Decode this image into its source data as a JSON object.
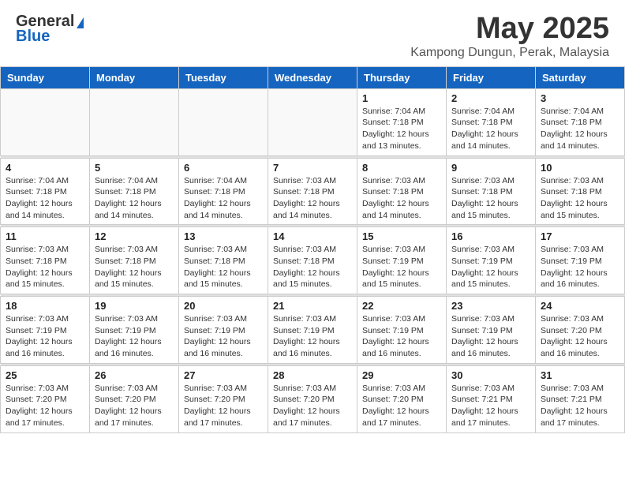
{
  "header": {
    "logo_general": "General",
    "logo_blue": "Blue",
    "title": "May 2025",
    "location": "Kampong Dungun, Perak, Malaysia"
  },
  "days_of_week": [
    "Sunday",
    "Monday",
    "Tuesday",
    "Wednesday",
    "Thursday",
    "Friday",
    "Saturday"
  ],
  "weeks": [
    [
      {
        "day": "",
        "info": ""
      },
      {
        "day": "",
        "info": ""
      },
      {
        "day": "",
        "info": ""
      },
      {
        "day": "",
        "info": ""
      },
      {
        "day": "1",
        "info": "Sunrise: 7:04 AM\nSunset: 7:18 PM\nDaylight: 12 hours\nand 13 minutes."
      },
      {
        "day": "2",
        "info": "Sunrise: 7:04 AM\nSunset: 7:18 PM\nDaylight: 12 hours\nand 14 minutes."
      },
      {
        "day": "3",
        "info": "Sunrise: 7:04 AM\nSunset: 7:18 PM\nDaylight: 12 hours\nand 14 minutes."
      }
    ],
    [
      {
        "day": "4",
        "info": "Sunrise: 7:04 AM\nSunset: 7:18 PM\nDaylight: 12 hours\nand 14 minutes."
      },
      {
        "day": "5",
        "info": "Sunrise: 7:04 AM\nSunset: 7:18 PM\nDaylight: 12 hours\nand 14 minutes."
      },
      {
        "day": "6",
        "info": "Sunrise: 7:04 AM\nSunset: 7:18 PM\nDaylight: 12 hours\nand 14 minutes."
      },
      {
        "day": "7",
        "info": "Sunrise: 7:03 AM\nSunset: 7:18 PM\nDaylight: 12 hours\nand 14 minutes."
      },
      {
        "day": "8",
        "info": "Sunrise: 7:03 AM\nSunset: 7:18 PM\nDaylight: 12 hours\nand 14 minutes."
      },
      {
        "day": "9",
        "info": "Sunrise: 7:03 AM\nSunset: 7:18 PM\nDaylight: 12 hours\nand 15 minutes."
      },
      {
        "day": "10",
        "info": "Sunrise: 7:03 AM\nSunset: 7:18 PM\nDaylight: 12 hours\nand 15 minutes."
      }
    ],
    [
      {
        "day": "11",
        "info": "Sunrise: 7:03 AM\nSunset: 7:18 PM\nDaylight: 12 hours\nand 15 minutes."
      },
      {
        "day": "12",
        "info": "Sunrise: 7:03 AM\nSunset: 7:18 PM\nDaylight: 12 hours\nand 15 minutes."
      },
      {
        "day": "13",
        "info": "Sunrise: 7:03 AM\nSunset: 7:18 PM\nDaylight: 12 hours\nand 15 minutes."
      },
      {
        "day": "14",
        "info": "Sunrise: 7:03 AM\nSunset: 7:18 PM\nDaylight: 12 hours\nand 15 minutes."
      },
      {
        "day": "15",
        "info": "Sunrise: 7:03 AM\nSunset: 7:19 PM\nDaylight: 12 hours\nand 15 minutes."
      },
      {
        "day": "16",
        "info": "Sunrise: 7:03 AM\nSunset: 7:19 PM\nDaylight: 12 hours\nand 15 minutes."
      },
      {
        "day": "17",
        "info": "Sunrise: 7:03 AM\nSunset: 7:19 PM\nDaylight: 12 hours\nand 16 minutes."
      }
    ],
    [
      {
        "day": "18",
        "info": "Sunrise: 7:03 AM\nSunset: 7:19 PM\nDaylight: 12 hours\nand 16 minutes."
      },
      {
        "day": "19",
        "info": "Sunrise: 7:03 AM\nSunset: 7:19 PM\nDaylight: 12 hours\nand 16 minutes."
      },
      {
        "day": "20",
        "info": "Sunrise: 7:03 AM\nSunset: 7:19 PM\nDaylight: 12 hours\nand 16 minutes."
      },
      {
        "day": "21",
        "info": "Sunrise: 7:03 AM\nSunset: 7:19 PM\nDaylight: 12 hours\nand 16 minutes."
      },
      {
        "day": "22",
        "info": "Sunrise: 7:03 AM\nSunset: 7:19 PM\nDaylight: 12 hours\nand 16 minutes."
      },
      {
        "day": "23",
        "info": "Sunrise: 7:03 AM\nSunset: 7:19 PM\nDaylight: 12 hours\nand 16 minutes."
      },
      {
        "day": "24",
        "info": "Sunrise: 7:03 AM\nSunset: 7:20 PM\nDaylight: 12 hours\nand 16 minutes."
      }
    ],
    [
      {
        "day": "25",
        "info": "Sunrise: 7:03 AM\nSunset: 7:20 PM\nDaylight: 12 hours\nand 17 minutes."
      },
      {
        "day": "26",
        "info": "Sunrise: 7:03 AM\nSunset: 7:20 PM\nDaylight: 12 hours\nand 17 minutes."
      },
      {
        "day": "27",
        "info": "Sunrise: 7:03 AM\nSunset: 7:20 PM\nDaylight: 12 hours\nand 17 minutes."
      },
      {
        "day": "28",
        "info": "Sunrise: 7:03 AM\nSunset: 7:20 PM\nDaylight: 12 hours\nand 17 minutes."
      },
      {
        "day": "29",
        "info": "Sunrise: 7:03 AM\nSunset: 7:20 PM\nDaylight: 12 hours\nand 17 minutes."
      },
      {
        "day": "30",
        "info": "Sunrise: 7:03 AM\nSunset: 7:21 PM\nDaylight: 12 hours\nand 17 minutes."
      },
      {
        "day": "31",
        "info": "Sunrise: 7:03 AM\nSunset: 7:21 PM\nDaylight: 12 hours\nand 17 minutes."
      }
    ]
  ]
}
